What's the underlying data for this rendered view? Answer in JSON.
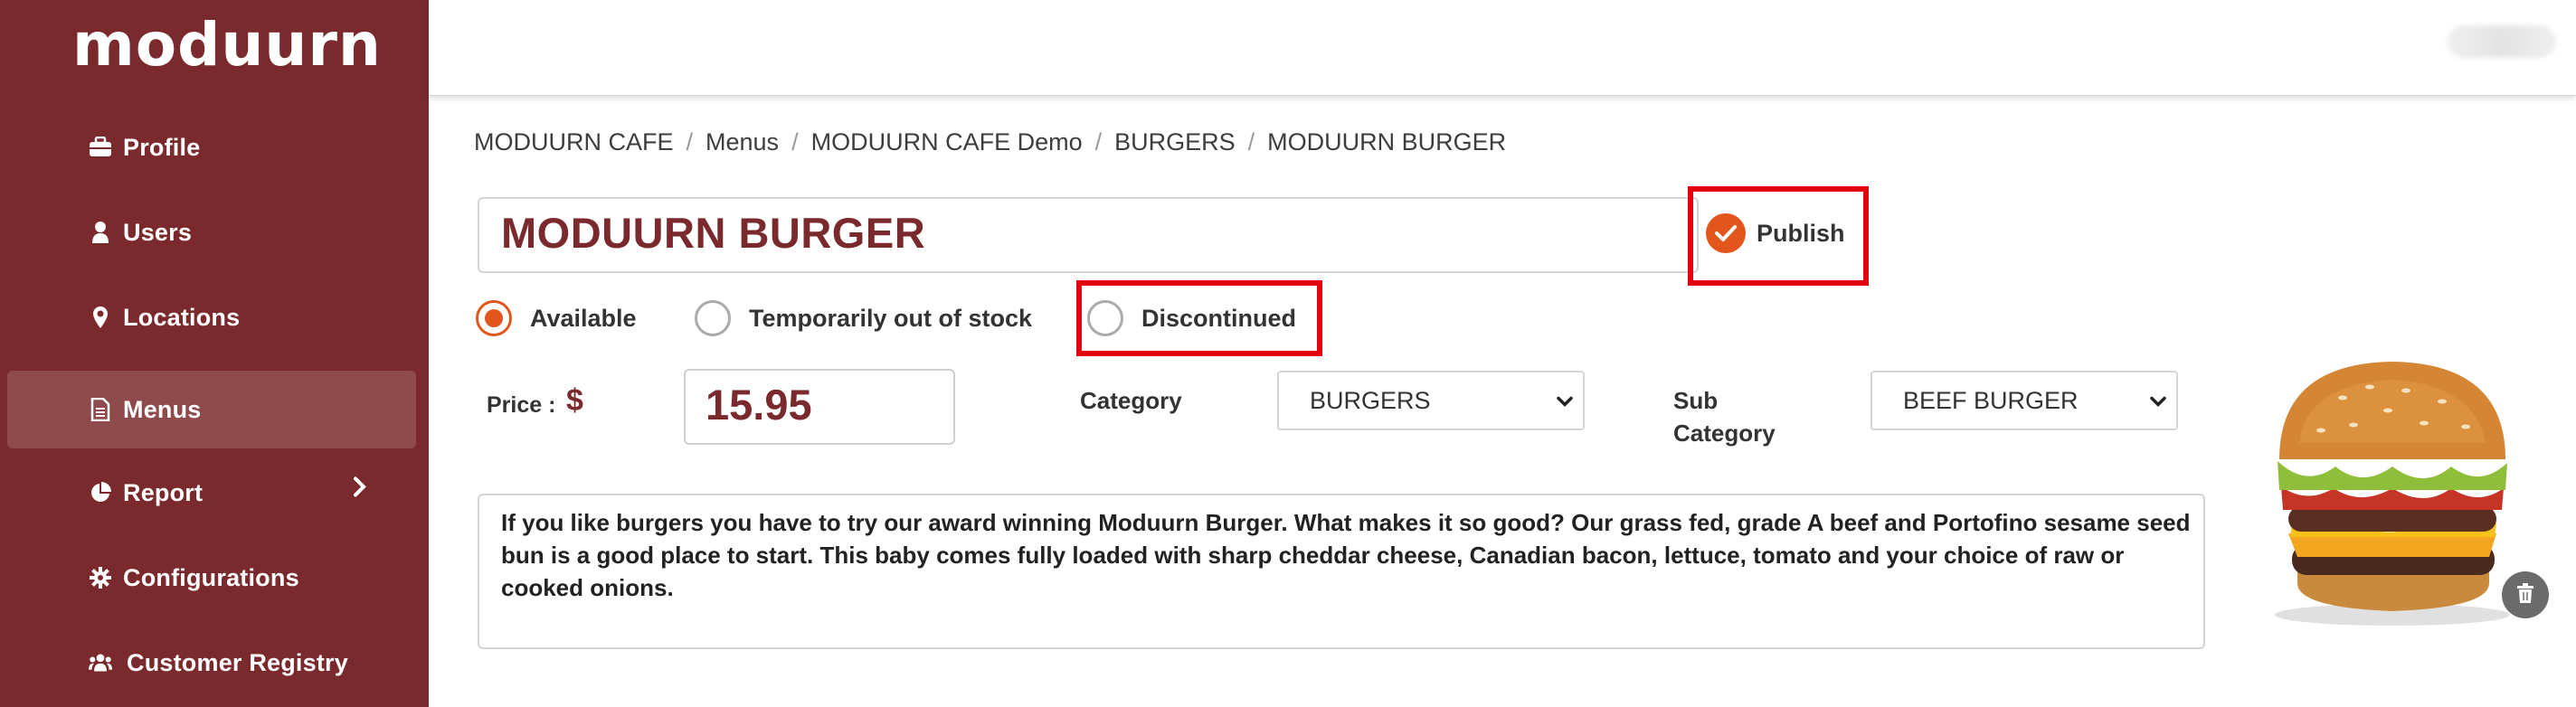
{
  "brand": {
    "logo_text": "moduurn",
    "sidebar_color": "#7a2a2c",
    "accent": "#e2561d",
    "highlight": "#e3000f"
  },
  "sidebar": {
    "items": [
      {
        "label": "Profile",
        "icon": "briefcase-icon"
      },
      {
        "label": "Users",
        "icon": "user-icon"
      },
      {
        "label": "Locations",
        "icon": "map-pin-icon"
      },
      {
        "label": "Menus",
        "icon": "document-icon",
        "active": true
      },
      {
        "label": "Report",
        "icon": "pie-chart-icon",
        "has_submenu": true
      },
      {
        "label": "Configurations",
        "icon": "gear-icon"
      },
      {
        "label": "Customer Registry",
        "icon": "users-group-icon"
      }
    ]
  },
  "breadcrumb": [
    "MODUURN CAFE",
    "Menus",
    "MODUURN CAFE Demo",
    "BURGERS",
    "MODUURN BURGER"
  ],
  "item": {
    "name": "MODUURN BURGER",
    "publish_label": "Publish",
    "published": true,
    "availability": {
      "options": [
        "Available",
        "Temporarily out of stock",
        "Discontinued"
      ],
      "selected": "Available"
    },
    "price_label": "Price :",
    "currency": "$",
    "price": "15.95",
    "category_label": "Category",
    "category": "BURGERS",
    "subcategory_label_line1": "Sub",
    "subcategory_label_line2": "Category",
    "subcategory": "BEEF BURGER",
    "description": "If you like burgers you have to try our award winning Moduurn Burger.  What makes it so good?  Our grass fed, grade A beef and Portofino sesame seed bun is a good place to start.  This baby comes fully loaded with sharp cheddar cheese, Canadian bacon, lettuce, tomato and your choice of raw or cooked onions."
  }
}
